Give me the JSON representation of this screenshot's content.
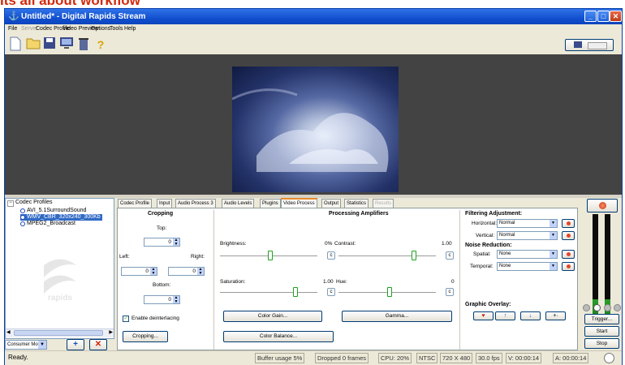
{
  "page_heading": "Its all about workflow",
  "window": {
    "title": "Untitled* - Digital Rapids Stream"
  },
  "menu": {
    "items": [
      "File",
      "Server",
      "Codec Profile",
      "Video Preview",
      "Options",
      "Tools",
      "Help"
    ]
  },
  "codec_profiles": {
    "root_label": "Codec Profiles",
    "items": [
      "AVI_5.1SurroundSound",
      "WMV_CBR_320x240_300Kb",
      "MPEG2_Broadcast"
    ],
    "selected_index": 1,
    "watermark": "rapids"
  },
  "consumer_mode": {
    "value": "Consumer Mode"
  },
  "tabs": [
    "Codec Profile",
    "Input",
    "Audio Process 3",
    "Audio Levels",
    "Plugins",
    "Video Process",
    "Output",
    "Statistics",
    "Results"
  ],
  "active_tab": "Video Process",
  "cropping": {
    "heading": "Cropping",
    "top_label": "Top:",
    "top_value": "0",
    "left_label": "Left:",
    "left_value": "0",
    "right_label": "Right:",
    "right_value": "0",
    "bottom_label": "Bottom:",
    "bottom_value": "0",
    "deinterlace_label": "Enable deinterlacing",
    "cropping_button": "Cropping..."
  },
  "processing": {
    "heading": "Processing Amplifiers",
    "brightness_label": "Brightness:",
    "brightness_value": "0%",
    "contrast_label": "Contrast:",
    "contrast_value": "1.00",
    "saturation_label": "Saturation:",
    "saturation_value": "1.00",
    "hue_label": "Hue:",
    "hue_value": "0",
    "color_gain_button": "Color Gain...",
    "gamma_button": "Gamma...",
    "color_balance_button": "Color Balance..."
  },
  "filtering": {
    "heading": "Filtering Adjustment:",
    "horizontal_label": "Horizontal:",
    "horizontal_value": "Normal",
    "vertical_label": "Vertical:",
    "vertical_value": "Normal"
  },
  "noise": {
    "heading": "Noise Reduction:",
    "spatial_label": "Spatial:",
    "spatial_value": "None",
    "temporal_label": "Temporal:",
    "temporal_value": "None"
  },
  "graphic_overlay": {
    "heading": "Graphic Overlay:"
  },
  "transport": {
    "trigger": "Trigger...",
    "start": "Start",
    "stop": "Stop"
  },
  "meters": {
    "left_level": 0.18,
    "right_level": 0.18
  },
  "status": {
    "ready": "Ready.",
    "buffer": "Buffer usage 5%",
    "dropped": "Dropped 0 frames",
    "cpu": "CPU: 20%",
    "standard": "NTSC",
    "resolution": "720 X 480",
    "fps": "30.0 fps",
    "video_time": "V: 00:00:14",
    "audio_time": "A: 00:00:14"
  },
  "colors": {
    "title_blue": "#1250cf",
    "heading_red": "#d22a0c",
    "meter_green": "#2a9d2a",
    "selection_blue": "#316ac5"
  },
  "icons": [
    "app-icon",
    "new-doc-icon",
    "open-folder-icon",
    "save-icon",
    "monitor-icon",
    "trash-icon",
    "help-icon",
    "preview-icon"
  ]
}
